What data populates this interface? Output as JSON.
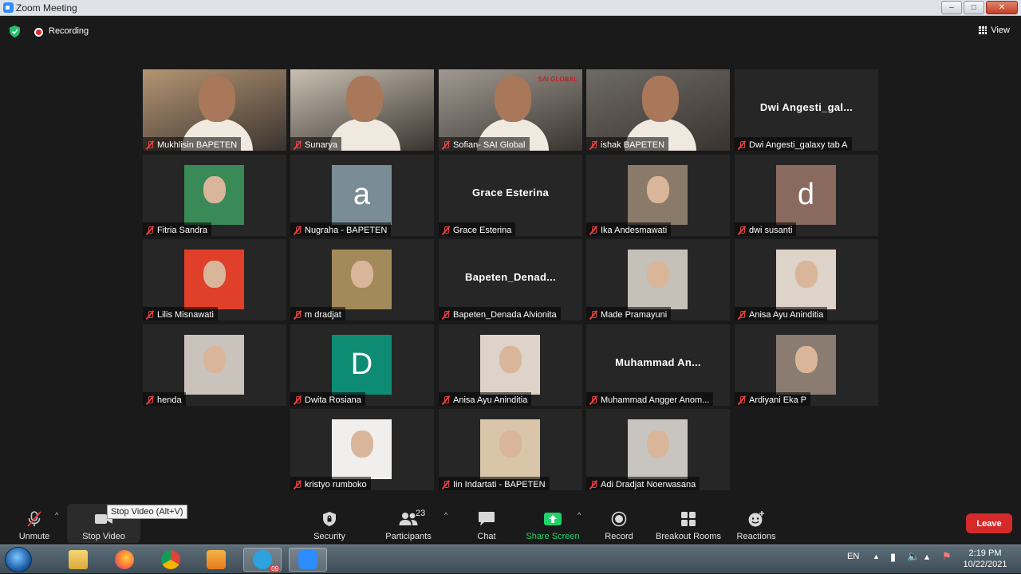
{
  "window": {
    "title": "Zoom Meeting"
  },
  "topbar": {
    "recording_label": "Recording",
    "view_label": "View"
  },
  "participants": [
    {
      "name": "Mukhlisin BAPETEN",
      "kind": "video",
      "bg": "#b59573"
    },
    {
      "name": "Sunarya",
      "kind": "video",
      "bg": "#c9c0b2"
    },
    {
      "name": "Sofian- SAI Global",
      "kind": "video",
      "bg": "#a09a92",
      "video_text": "SAI GLOBAL"
    },
    {
      "name": "ishak BAPETEN",
      "kind": "video",
      "bg": "#6e6a66",
      "active": true
    },
    {
      "name": "Dwi Angesti_galaxy tab A",
      "kind": "name",
      "display_name": "Dwi  Angesti_gal..."
    },
    {
      "name": "Fitria Sandra",
      "kind": "photo",
      "bg": "#3a8a57"
    },
    {
      "name": "Nugraha - BAPETEN",
      "kind": "avatar",
      "initial": "a",
      "bg": "#7a8c95"
    },
    {
      "name": "Grace Esterina",
      "kind": "name",
      "display_name": "Grace Esterina"
    },
    {
      "name": "Ika Andesmawati",
      "kind": "photo",
      "bg": "#8a7a6a"
    },
    {
      "name": "dwi susanti",
      "kind": "avatar",
      "initial": "d",
      "bg": "#8a6a5e"
    },
    {
      "name": "Lilis Misnawati",
      "kind": "photo",
      "bg": "#e0402a"
    },
    {
      "name": "m dradjat",
      "kind": "photo",
      "bg": "#a38a5a"
    },
    {
      "name": "Bapeten_Denada Alvionita",
      "kind": "name",
      "display_name": "Bapeten_Denad..."
    },
    {
      "name": "Made Pramayuni",
      "kind": "photo",
      "bg": "#c5c0b8"
    },
    {
      "name": "Anisa Ayu Aninditia",
      "kind": "photo",
      "bg": "#ddd3c8"
    },
    {
      "name": "henda",
      "kind": "photo",
      "bg": "#c9c3bb"
    },
    {
      "name": "Dwita Rosiana",
      "kind": "avatar",
      "initial": "D",
      "bg": "#0e8c73"
    },
    {
      "name": "Anisa Ayu Aninditia",
      "kind": "photo",
      "bg": "#ddd3c8"
    },
    {
      "name": "Muhammad Angger Anom...",
      "kind": "name",
      "display_name": "Muhammad  An..."
    },
    {
      "name": "Ardiyani Eka P",
      "kind": "photo",
      "bg": "#8a7c70"
    },
    {
      "name": "kristyo rumboko",
      "kind": "photo",
      "bg": "#f0efee"
    },
    {
      "name": "Iin Indartati - BAPETEN",
      "kind": "photo",
      "bg": "#d9c6a8"
    },
    {
      "name": "Adi Dradjat Noerwasana",
      "kind": "photo",
      "bg": "#c8c4bf"
    }
  ],
  "toolbar": {
    "unmute": "Unmute",
    "stop_video": "Stop Video",
    "tooltip": "Stop Video (Alt+V)",
    "security": "Security",
    "participants": "Participants",
    "participant_count": "23",
    "chat": "Chat",
    "share_screen": "Share Screen",
    "record": "Record",
    "breakout_rooms": "Breakout Rooms",
    "reactions": "Reactions",
    "leave": "Leave"
  },
  "taskbar": {
    "language": "EN",
    "time": "2:19 PM",
    "date": "10/22/2021",
    "telegram_badge": "09"
  },
  "colors": {
    "accent_green": "#1fd36b",
    "active_speaker": "#d9ea6a",
    "leave_red": "#d42a2a"
  }
}
